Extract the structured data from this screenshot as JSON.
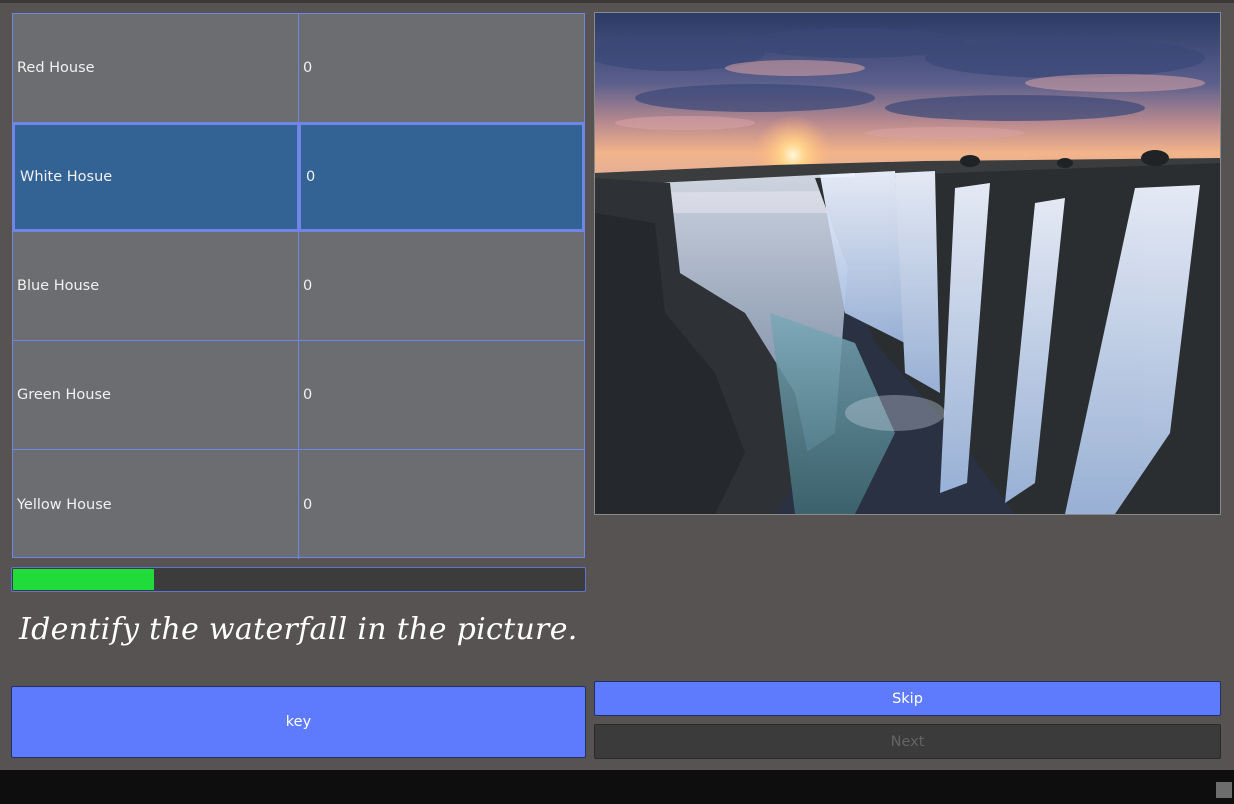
{
  "scoreboard": {
    "rows": [
      {
        "name": "Red House",
        "score": "0"
      },
      {
        "name": "White Hosue",
        "score": "0"
      },
      {
        "name": "Blue House",
        "score": "0"
      },
      {
        "name": "Green House",
        "score": "0"
      },
      {
        "name": "Yellow House",
        "score": "0"
      }
    ],
    "selected_index": 1
  },
  "timer": {
    "progress_fraction": 0.25,
    "fill_color": "#1fdc3b"
  },
  "question": {
    "text": "Identify the waterfall in the picture."
  },
  "buttons": {
    "key_label": "key",
    "skip_label": "Skip",
    "next_label": "Next"
  },
  "colors": {
    "accent": "#5f7bfd",
    "selected_row": "#336394",
    "table_bg": "#6b6d71",
    "app_bg": "#575352"
  }
}
